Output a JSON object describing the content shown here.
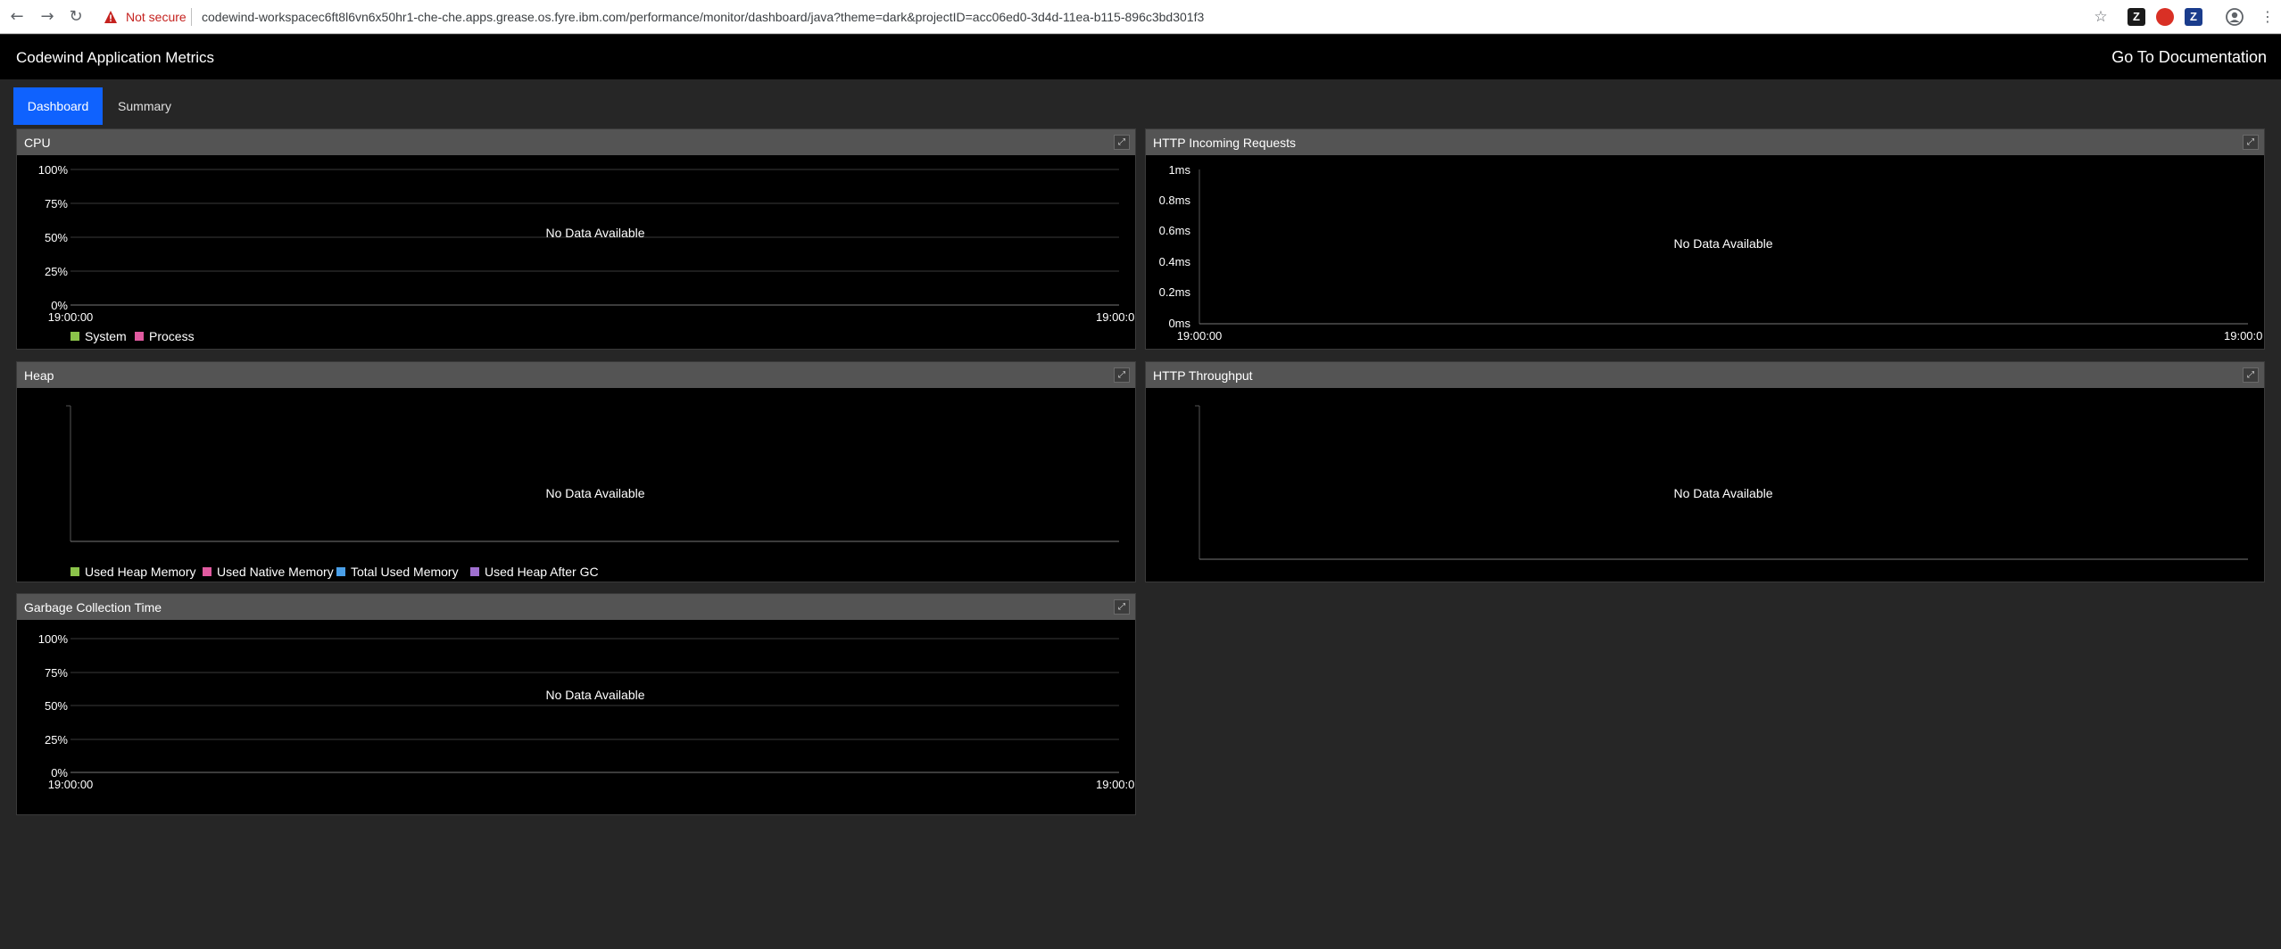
{
  "browser": {
    "security_label": "Not secure",
    "url": "codewind-workspacec6ft8l6vn6x50hr1-che-che.apps.grease.os.fyre.ibm.com/performance/monitor/dashboard/java?theme=dark&projectID=acc06ed0-3d4d-11ea-b115-896c3bd301f3",
    "extensions": [
      {
        "name": "zotero-extension-icon",
        "label": "Z",
        "color": "#1a1a1a"
      },
      {
        "name": "adblock-extension-icon",
        "label": "",
        "color": "#d93025"
      },
      {
        "name": "z-extension-icon",
        "label": "Z",
        "color": "#1a3c8c"
      }
    ]
  },
  "header": {
    "title": "Codewind Application Metrics",
    "doc_link": "Go To Documentation"
  },
  "tabs": [
    {
      "label": "Dashboard",
      "active": true
    },
    {
      "label": "Summary",
      "active": false
    }
  ],
  "colors": {
    "accent": "#0f62fe",
    "system": "#8bc34a",
    "process": "#e05aa0",
    "used_heap": "#8bc34a",
    "used_native": "#e05aa0",
    "total_used": "#4a9fe8",
    "heap_after_gc": "#a070d0"
  },
  "panels": {
    "cpu": {
      "title": "CPU",
      "no_data": "No Data Available",
      "y_ticks": [
        "100%",
        "75%",
        "50%",
        "25%",
        "0%"
      ],
      "x_ticks": [
        "19:00:00",
        "19:00:0"
      ],
      "legend": [
        "System",
        "Process"
      ]
    },
    "http_requests": {
      "title": "HTTP Incoming Requests",
      "no_data": "No Data Available",
      "y_ticks": [
        "1ms",
        "0.8ms",
        "0.6ms",
        "0.4ms",
        "0.2ms",
        "0ms"
      ],
      "x_ticks": [
        "19:00:00",
        "19:00:0"
      ]
    },
    "heap": {
      "title": "Heap",
      "no_data": "No Data Available",
      "legend": [
        "Used Heap Memory",
        "Used Native Memory",
        "Total Used Memory",
        "Used Heap After GC"
      ]
    },
    "http_throughput": {
      "title": "HTTP Throughput",
      "no_data": "No Data Available"
    },
    "gc": {
      "title": "Garbage Collection Time",
      "no_data": "No Data Available",
      "y_ticks": [
        "100%",
        "75%",
        "50%",
        "25%",
        "0%"
      ],
      "x_ticks": [
        "19:00:00",
        "19:00:0"
      ]
    }
  }
}
